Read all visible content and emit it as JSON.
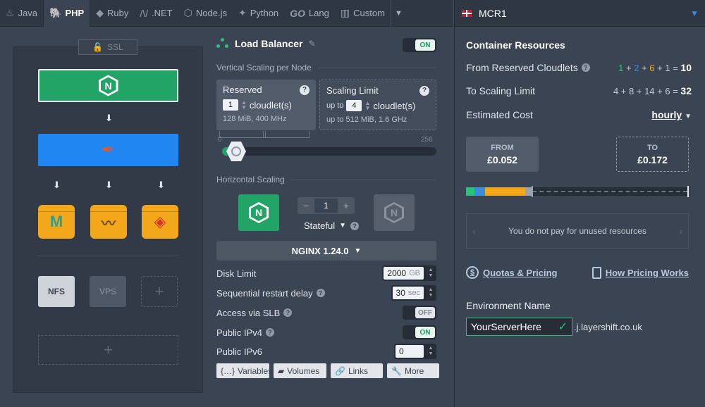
{
  "tabs": [
    {
      "label": "Java",
      "icon": "java-icon",
      "glyph": "♨",
      "active": false
    },
    {
      "label": "PHP",
      "icon": "php-icon",
      "glyph": "🐘",
      "active": true
    },
    {
      "label": "Ruby",
      "icon": "ruby-icon",
      "glyph": "◆",
      "active": false
    },
    {
      "label": ".NET",
      "icon": "dotnet-icon",
      "glyph": "/\\/",
      "active": false
    },
    {
      "label": "Node.js",
      "icon": "nodejs-icon",
      "glyph": "⬡",
      "active": false
    },
    {
      "label": "Python",
      "icon": "python-icon",
      "glyph": "✦",
      "active": false
    },
    {
      "label": "Lang",
      "icon": "go-icon",
      "glyph": "GO",
      "active": false
    },
    {
      "label": "Custom",
      "icon": "custom-icon",
      "glyph": "▥",
      "active": false
    }
  ],
  "topology": {
    "ssl_label": "SSL",
    "nfs_label": "NFS",
    "vps_label": "VPS",
    "lb_glyph": "N",
    "mysql_glyph": "M",
    "plus": "+"
  },
  "config": {
    "title": "Load Balancer",
    "enabled_toggle": "ON",
    "vertical_section": "Vertical Scaling per Node",
    "reserved": {
      "title": "Reserved",
      "value": "1",
      "unit": "cloudlet(s)",
      "specs": "128 MiB, 400 MHz"
    },
    "scaling_limit": {
      "title": "Scaling Limit",
      "prefix": "up to",
      "value": "4",
      "unit": "cloudlet(s)",
      "specs": "up to 512 MiB, 1.6 GHz"
    },
    "slider": {
      "min": "0",
      "max": "256"
    },
    "horizontal_section": "Horizontal Scaling",
    "node_count": "1",
    "node_mode": "Stateful",
    "version": "NGINX 1.24.0",
    "disk_limit": {
      "label": "Disk Limit",
      "value": "2000",
      "unit": "GB"
    },
    "restart_delay": {
      "label": "Sequential restart delay",
      "value": "30",
      "unit": "sec"
    },
    "slb": {
      "label": "Access via SLB",
      "state": "OFF"
    },
    "ipv4": {
      "label": "Public IPv4",
      "state": "ON"
    },
    "ipv6": {
      "label": "Public IPv6",
      "value": "0"
    },
    "buttons": {
      "variables": "Variables",
      "volumes": "Volumes",
      "links": "Links",
      "more": "More"
    }
  },
  "resources": {
    "region": "MCR1",
    "title": "Container Resources",
    "reserved_label": "From Reserved Cloudlets",
    "reserved_terms": [
      "1",
      "2",
      "6",
      "1"
    ],
    "reserved_total": "10",
    "limit_label": "To Scaling Limit",
    "limit_terms": [
      "4",
      "8",
      "14",
      "6"
    ],
    "limit_total": "32",
    "cost_label": "Estimated Cost",
    "period": "hourly",
    "from_label": "FROM",
    "from_value": "£0.052",
    "to_label": "TO",
    "to_value": "£0.172",
    "unused_note": "You do not pay for unused resources",
    "quotas_link": "Quotas & Pricing",
    "pricing_link": "How Pricing Works",
    "env_label": "Environment Name",
    "env_value": "YourServerHere",
    "env_domain": ".j.layershift.co.uk"
  },
  "colors": {
    "accent_green": "#21a465",
    "accent_blue": "#1f86f2",
    "accent_orange": "#f3a81c",
    "bg": "#3b4452"
  }
}
